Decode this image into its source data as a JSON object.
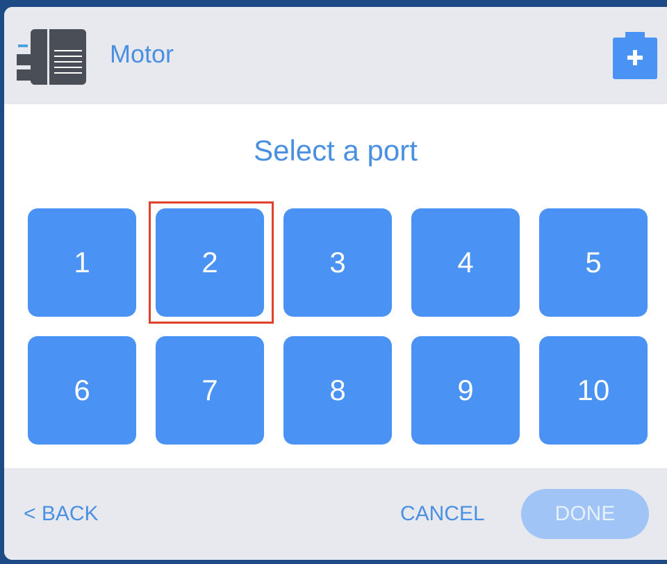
{
  "header": {
    "title": "Motor",
    "device_icon": "motor-device-icon",
    "add_icon": "add-battery-icon"
  },
  "prompt": "Select a port",
  "ports": [
    "1",
    "2",
    "3",
    "4",
    "5",
    "6",
    "7",
    "8",
    "9",
    "10"
  ],
  "selected_port": "2",
  "footer": {
    "back_label": "< BACK",
    "cancel_label": "CANCEL",
    "done_label": "DONE"
  },
  "colors": {
    "accent": "#4a90e2",
    "port_fill": "#4a93f5",
    "selection_outline": "#e1402b",
    "done_disabled": "#9fc4f5",
    "header_bg": "#e8e9ee"
  }
}
